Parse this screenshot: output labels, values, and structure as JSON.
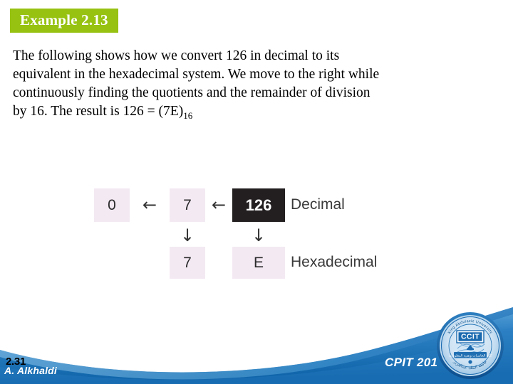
{
  "slide": {
    "title": "Example 2.13",
    "title_bg_color": "#97c212",
    "body": {
      "line1": "The following shows how we convert 126 in decimal to its",
      "line2": "equivalent in the hexadecimal system. We move to the right while",
      "line3": "continuously finding the quotients and the remainder of division",
      "line4_main": "by 16. The result is 126 = (7E)",
      "line4_subscript": "16"
    }
  },
  "diagram": {
    "box_color": "#f3e9f3",
    "highlight_color": "#231f20",
    "top_row": {
      "quotient_zero": "0",
      "quotient_seven": "7",
      "source_value": "126",
      "label": "Decimal"
    },
    "bottom_row": {
      "remainder_seven": "7",
      "remainder_e": "E",
      "label": "Hexadecimal"
    },
    "arrows": {
      "left_arrow": "←",
      "down_arrow": "↓"
    }
  },
  "footer": {
    "slide_number": "2.31",
    "author": "A. Alkhaldi",
    "course_code": "CPIT 201",
    "wave_color": "#2a7fc4",
    "logo": {
      "acronym": "CCIT",
      "ring_text_top": "King Abdulaziz University",
      "ring_text_bottom": "جامعة الملك عبدالعزيز",
      "banner_text": "كلية الحاسبات وتقنية المعلومات"
    }
  }
}
